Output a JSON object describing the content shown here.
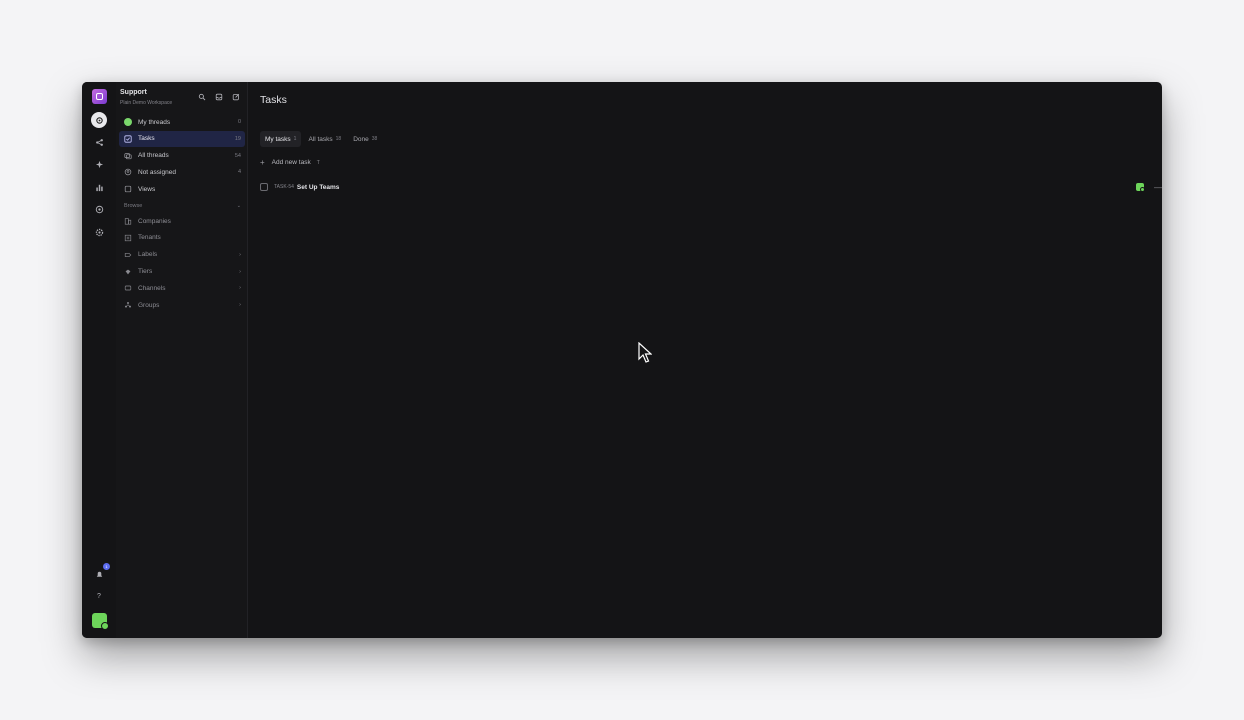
{
  "workspace": {
    "name": "Support",
    "subtitle": "Plain Demo Workspace"
  },
  "nav": {
    "items": [
      {
        "label": "My threads",
        "count": "0"
      },
      {
        "label": "Tasks",
        "count": "19"
      },
      {
        "label": "All threads",
        "count": "54"
      },
      {
        "label": "Not assigned",
        "count": "4"
      },
      {
        "label": "Views",
        "count": ""
      }
    ],
    "section_label": "Browse",
    "browse_items": [
      {
        "label": "Companies",
        "count": ""
      },
      {
        "label": "Tenants",
        "count": ""
      },
      {
        "label": "Labels",
        "count": "›"
      },
      {
        "label": "Tiers",
        "count": "›"
      },
      {
        "label": "Channels",
        "count": "›"
      },
      {
        "label": "Groups",
        "count": "›"
      }
    ]
  },
  "main": {
    "title": "Tasks",
    "tabs": [
      {
        "label": "My tasks",
        "count": "1"
      },
      {
        "label": "All tasks",
        "count": "18"
      },
      {
        "label": "Done",
        "count": "38"
      }
    ],
    "add_task_label": "Add new task",
    "add_task_shortcut": "T",
    "tasks": [
      {
        "id": "TASK-54",
        "name": "Set Up Teams"
      }
    ]
  },
  "rail": {
    "notification_count": "1",
    "help_label": "?"
  },
  "colors": {
    "accent": "#202545",
    "status_green": "#7ad66b",
    "background": "#141416"
  },
  "icons": [
    "logo-icon",
    "home-icon",
    "share-icon",
    "sparkle-icon",
    "chart-icon",
    "target-icon",
    "settings-icon",
    "bell-icon",
    "help-icon",
    "search-icon",
    "inbox-icon",
    "compose-icon"
  ]
}
